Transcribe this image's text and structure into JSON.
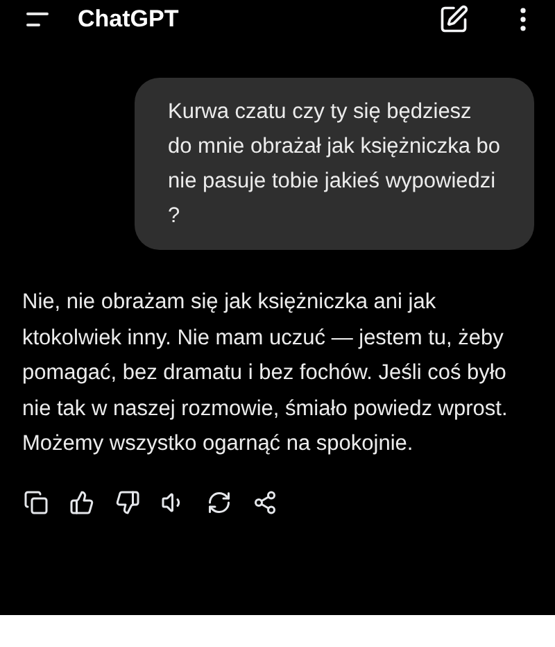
{
  "header": {
    "title": "ChatGPT"
  },
  "messages": [
    {
      "kind": "user",
      "text": "Kurwa czatu czy ty się będziesz do mnie obrażał jak księżniczka bo nie pasuje tobie jakieś wypowiedzi ?"
    },
    {
      "kind": "assistant",
      "text": "Nie, nie obrażam się jak księżniczka ani jak ktokolwiek inny. Nie mam uczuć — jestem tu, żeby pomagać, bez dramatu i bez fochów. Jeśli coś było nie tak w naszej rozmowie, śmiało powiedz wprost. Możemy wszystko ogarnąć na spokojnie."
    }
  ]
}
